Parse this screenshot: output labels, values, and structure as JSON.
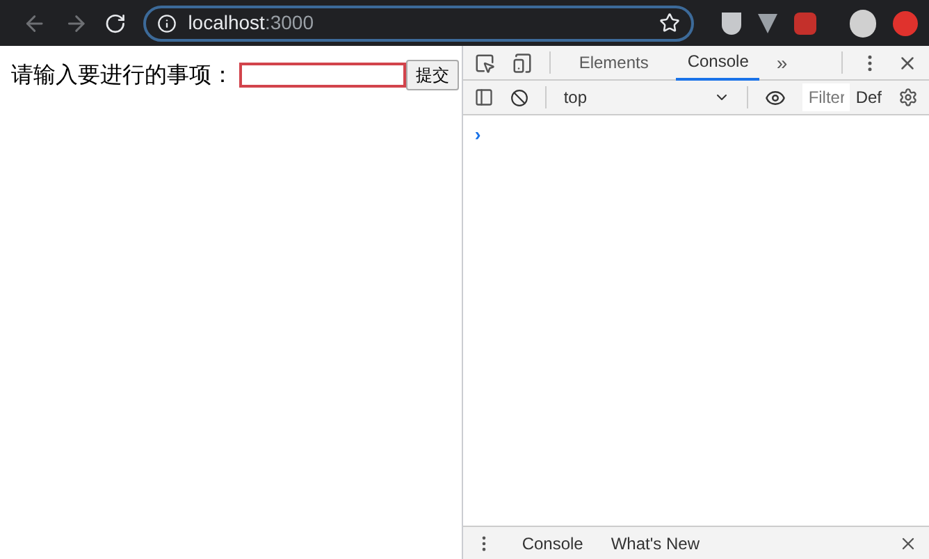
{
  "browser": {
    "url_host": "localhost",
    "url_port": ":3000"
  },
  "page": {
    "label": "请输入要进行的事项：",
    "input": {
      "focused": true
    },
    "submit": "提交"
  },
  "devtools": {
    "tabs": [
      {
        "label": "Elements",
        "selected": false
      },
      {
        "label": "Console",
        "selected": true
      }
    ],
    "more": "»",
    "context": "top",
    "filter_placeholder": "Filter",
    "levels": "Def",
    "prompt": "›",
    "drawer_tabs": [
      {
        "label": "Console"
      },
      {
        "label": "What's New"
      }
    ]
  }
}
